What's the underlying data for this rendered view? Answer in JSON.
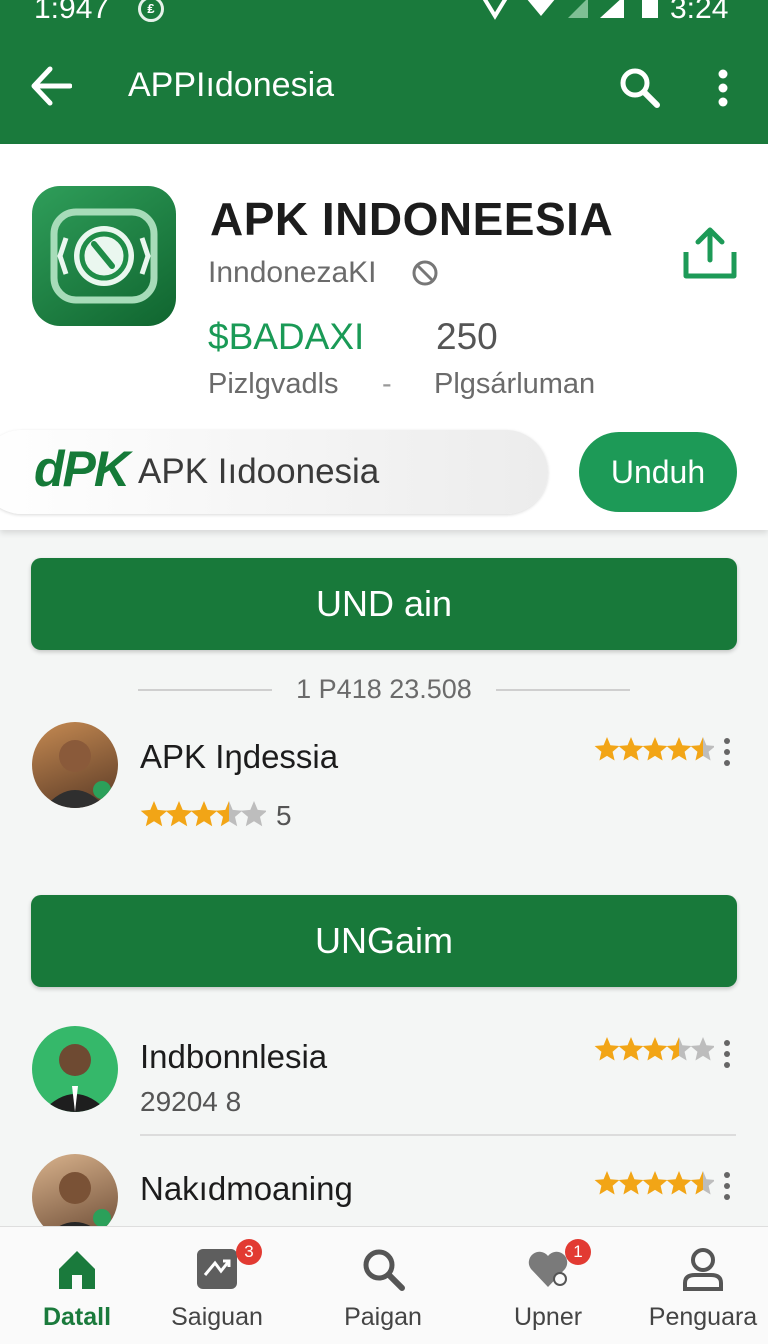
{
  "status": {
    "time_left": "1:947",
    "time_right": "3:24"
  },
  "app_bar": {
    "title": "APPIıdonesia"
  },
  "header": {
    "app_name": "APK INDONEESIA",
    "developer": "InndonezaKI",
    "stat1_value": "$BADAXI",
    "stat1_label": "Pizlgvadls",
    "stat_sep": "-",
    "stat2_value": "250",
    "stat2_label": "Plgsárluman",
    "brand_mark": "dPK",
    "brand_text": "APK Iıdoonesia",
    "unduh_label": "Unduh",
    "colors": {
      "primary": "#1a7a3c",
      "accent": "#1d9a57"
    }
  },
  "main": {
    "primary_button": "UND ain",
    "divider_text": "1 P418 23.508",
    "secondary_button": "UNGaim",
    "reviews": [
      {
        "name": "APK Iŋdessia",
        "meta": "5",
        "user_rating": 3.5,
        "right_rating": 4.5
      },
      {
        "name": "Indbonnlesia",
        "meta": "29204  8",
        "right_rating": 3.5
      },
      {
        "name": "Nakıdmoaning",
        "right_rating": 4.5
      }
    ]
  },
  "bottom_nav": [
    {
      "label": "Datall",
      "icon": "home-icon",
      "active": true
    },
    {
      "label": "Saiguan",
      "icon": "shuffle-icon",
      "badge": "3"
    },
    {
      "label": "Paigan",
      "icon": "search-icon"
    },
    {
      "label": "Upner",
      "icon": "heart-icon",
      "badge": "1"
    },
    {
      "label": "Penguara",
      "icon": "person-icon"
    }
  ]
}
